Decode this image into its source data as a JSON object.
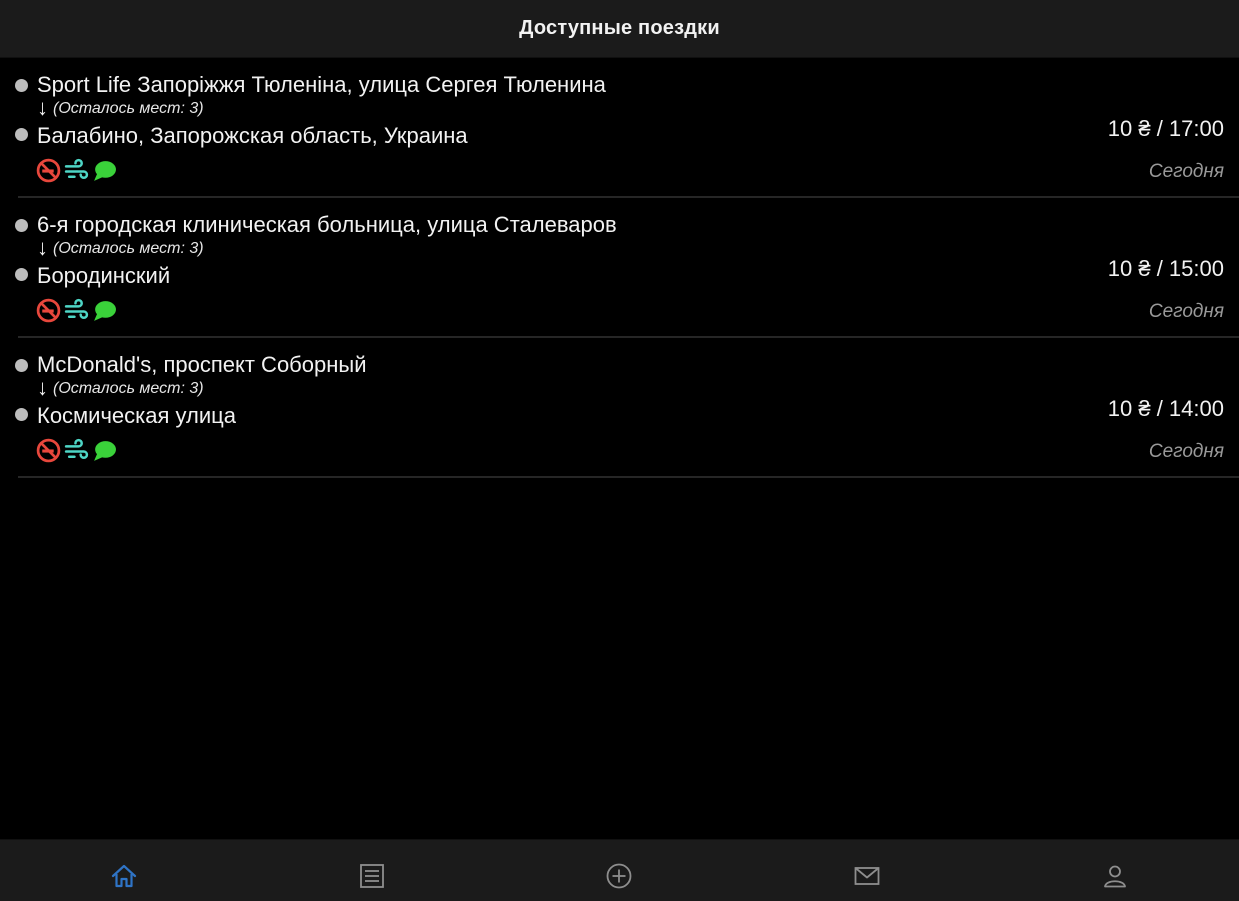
{
  "header": {
    "title": "Доступные поездки"
  },
  "trips": [
    {
      "from": "Sport Life Запоріжжя Тюленіна, улица Сергея Тюленина",
      "seats": "(Осталось мест: 3)",
      "to": "Балабино, Запорожская область, Украина",
      "price_time": "10 ₴ / 17:00",
      "date": "Сегодня",
      "icons": [
        "no-smoking-icon",
        "air-conditioning-icon",
        "chat-icon"
      ]
    },
    {
      "from": "6-я городская клиническая больница, улица Сталеваров",
      "seats": "(Осталось мест: 3)",
      "to": "Бородинский",
      "price_time": "10 ₴ / 15:00",
      "date": "Сегодня",
      "icons": [
        "no-smoking-icon",
        "air-conditioning-icon",
        "chat-icon"
      ]
    },
    {
      "from": "McDonald's, проспект Соборный",
      "seats": "(Осталось мест: 3)",
      "to": "Космическая улица",
      "price_time": "10 ₴ / 14:00",
      "date": "Сегодня",
      "icons": [
        "no-smoking-icon",
        "air-conditioning-icon",
        "chat-icon"
      ]
    }
  ],
  "tabbar": {
    "items": [
      {
        "icon": "home-icon",
        "active": true
      },
      {
        "icon": "list-icon",
        "active": false
      },
      {
        "icon": "add-circle-icon",
        "active": false
      },
      {
        "icon": "mail-icon",
        "active": false
      },
      {
        "icon": "profile-icon",
        "active": false
      }
    ]
  },
  "colors": {
    "background": "#000000",
    "bar_background": "#1b1b1b",
    "text": "#f2f2f2",
    "muted_text": "#9a9a9a",
    "no_smoking": "#e8473c",
    "air_conditioning": "#4ed6c6",
    "chat": "#3ad13a",
    "tab_active": "#2f74c6",
    "tab_inactive": "#8e8e8e"
  }
}
